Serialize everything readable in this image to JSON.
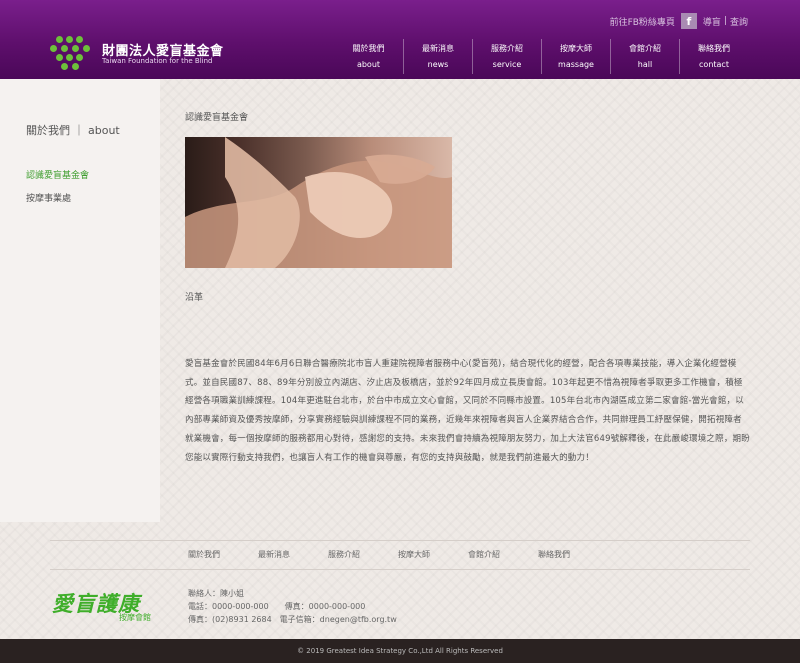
{
  "header": {
    "logo_zh": "財團法人愛盲基金會",
    "logo_en": "Taiwan Foundation for the Blind",
    "top_links": {
      "website_link": "前往FB粉絲專頁",
      "facebook_icon": "f",
      "link_home": "導盲",
      "link_search": "查詢"
    },
    "nav": [
      {
        "zh": "關於我們",
        "en": "about"
      },
      {
        "zh": "最新消息",
        "en": "news"
      },
      {
        "zh": "服務介紹",
        "en": "service"
      },
      {
        "zh": "按摩大師",
        "en": "massage"
      },
      {
        "zh": "會館介紹",
        "en": "hall"
      },
      {
        "zh": "聯絡我們",
        "en": "contact"
      }
    ]
  },
  "sidebar": {
    "title": "關於我們 ｜ about",
    "items": [
      {
        "label": "認識愛盲基金會",
        "active": true
      },
      {
        "label": "按摩事業處",
        "active": false
      }
    ]
  },
  "main": {
    "page_title": "認識愛盲基金會",
    "photo_alt": "massage-photo",
    "lead": "沿革",
    "body": "愛盲基金會於民國84年6月6日聯合醫療院北市盲人重建院視障者服務中心(愛盲苑)，結合現代化的經營，配合各項專業技能，導入企業化經營模式。並自民國87、88、89年分別設立內湖店、汐止店及板橋店，並於92年四月成立長庚會館。103年起更不惜為視障者爭取更多工作機會，積極經營各項職業訓練課程。104年更進駐台北市，於台中市成立文心會館，又同於不同縣市設置。105年台北市內湖區成立第二家會館-當光會館，以內部專業師資及優秀按摩師，分享實務經驗與訓練課程不同的業務，近幾年來視障者與盲人企業界結合合作，共同辦理員工紓壓保健，開拓視障者就業機會，每一個按摩師的服務都用心對待，感謝您的支持。未來我們會持續為視障朋友努力，加上大法官649號解釋後，在此嚴峻環境之際，期盼您能以實際行動支持我們，也讓盲人有工作的機會與尊嚴，有您的支持與鼓勵，就是我們前進最大的動力！"
  },
  "footer": {
    "nav": [
      "關於我們",
      "最新消息",
      "服務介紹",
      "按摩大師",
      "會館介紹",
      "聯絡我們"
    ],
    "logo_big": "愛盲護康",
    "logo_small": "按摩會館",
    "contact_person": "聯絡人：陳小姐",
    "phone": "電話：0000-000-000　　傳真：0000-000-000",
    "fax_email": "傳真：(02)8931 2684　電子信箱：dnegen@tfb.org.tw",
    "copyright": "© 2019 Greatest Idea Strategy Co.,Ltd All Rights Reserved"
  }
}
